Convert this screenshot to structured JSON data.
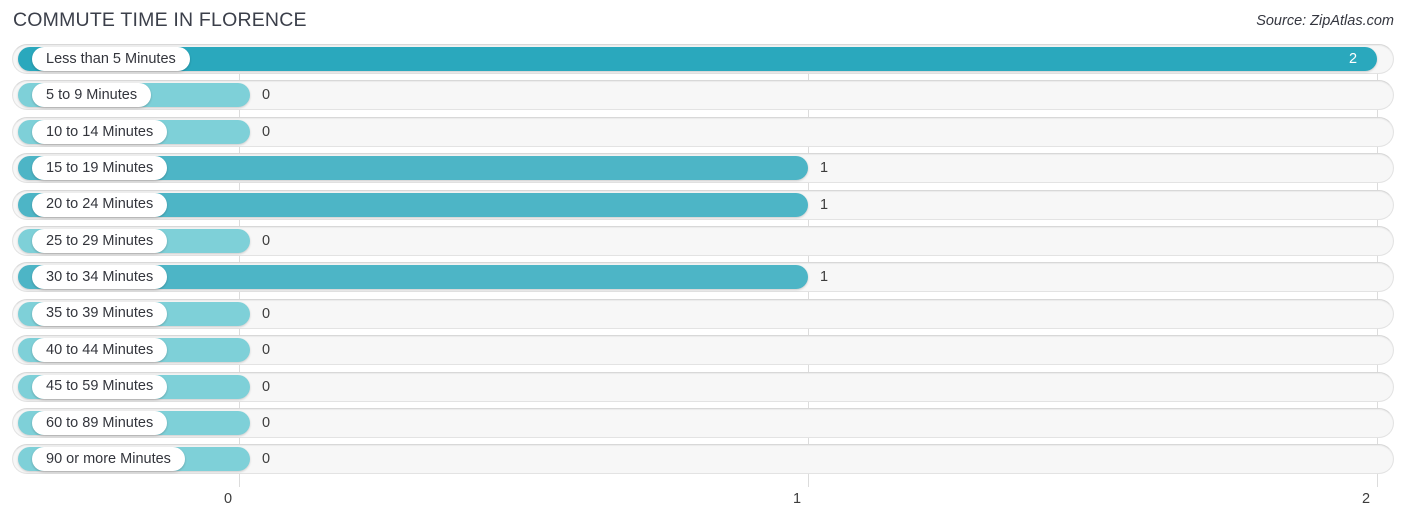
{
  "header": {
    "title": "COMMUTE TIME IN FLORENCE",
    "source": "Source: ZipAtlas.com"
  },
  "colors": {
    "bar_high": "#2aa8bd",
    "bar_mid": "#4db5c6",
    "bar_zero": "#7ed0d8",
    "track": "#f7f7f7",
    "gridline": "#dcdcdc",
    "text": "#33353c",
    "value_inside": "#ffffff"
  },
  "axis": {
    "ticks": [
      "0",
      "1",
      "2"
    ],
    "min": 0,
    "max": 2
  },
  "chart_data": {
    "type": "bar",
    "orientation": "horizontal",
    "title": "COMMUTE TIME IN FLORENCE",
    "subtitle": "Source: ZipAtlas.com",
    "xlabel": "",
    "ylabel": "",
    "xlim": [
      0,
      2
    ],
    "grid": true,
    "legend": "none",
    "categories": [
      "Less than 5 Minutes",
      "5 to 9 Minutes",
      "10 to 14 Minutes",
      "15 to 19 Minutes",
      "20 to 24 Minutes",
      "25 to 29 Minutes",
      "30 to 34 Minutes",
      "35 to 39 Minutes",
      "40 to 44 Minutes",
      "45 to 59 Minutes",
      "60 to 89 Minutes",
      "90 or more Minutes"
    ],
    "values": [
      2,
      0,
      0,
      1,
      1,
      0,
      1,
      0,
      0,
      0,
      0,
      0
    ],
    "value_labels": [
      "2",
      "0",
      "0",
      "1",
      "1",
      "0",
      "1",
      "0",
      "0",
      "0",
      "0",
      "0"
    ]
  },
  "rows": [
    {
      "label": "Less than 5 Minutes",
      "value": 2,
      "value_label": "2",
      "inside": true
    },
    {
      "label": "5 to 9 Minutes",
      "value": 0,
      "value_label": "0",
      "inside": false
    },
    {
      "label": "10 to 14 Minutes",
      "value": 0,
      "value_label": "0",
      "inside": false
    },
    {
      "label": "15 to 19 Minutes",
      "value": 1,
      "value_label": "1",
      "inside": false
    },
    {
      "label": "20 to 24 Minutes",
      "value": 1,
      "value_label": "1",
      "inside": false
    },
    {
      "label": "25 to 29 Minutes",
      "value": 0,
      "value_label": "0",
      "inside": false
    },
    {
      "label": "30 to 34 Minutes",
      "value": 1,
      "value_label": "1",
      "inside": false
    },
    {
      "label": "35 to 39 Minutes",
      "value": 0,
      "value_label": "0",
      "inside": false
    },
    {
      "label": "40 to 44 Minutes",
      "value": 0,
      "value_label": "0",
      "inside": false
    },
    {
      "label": "45 to 59 Minutes",
      "value": 0,
      "value_label": "0",
      "inside": false
    },
    {
      "label": "60 to 89 Minutes",
      "value": 0,
      "value_label": "0",
      "inside": false
    },
    {
      "label": "90 or more Minutes",
      "value": 0,
      "value_label": "0",
      "inside": false
    }
  ]
}
